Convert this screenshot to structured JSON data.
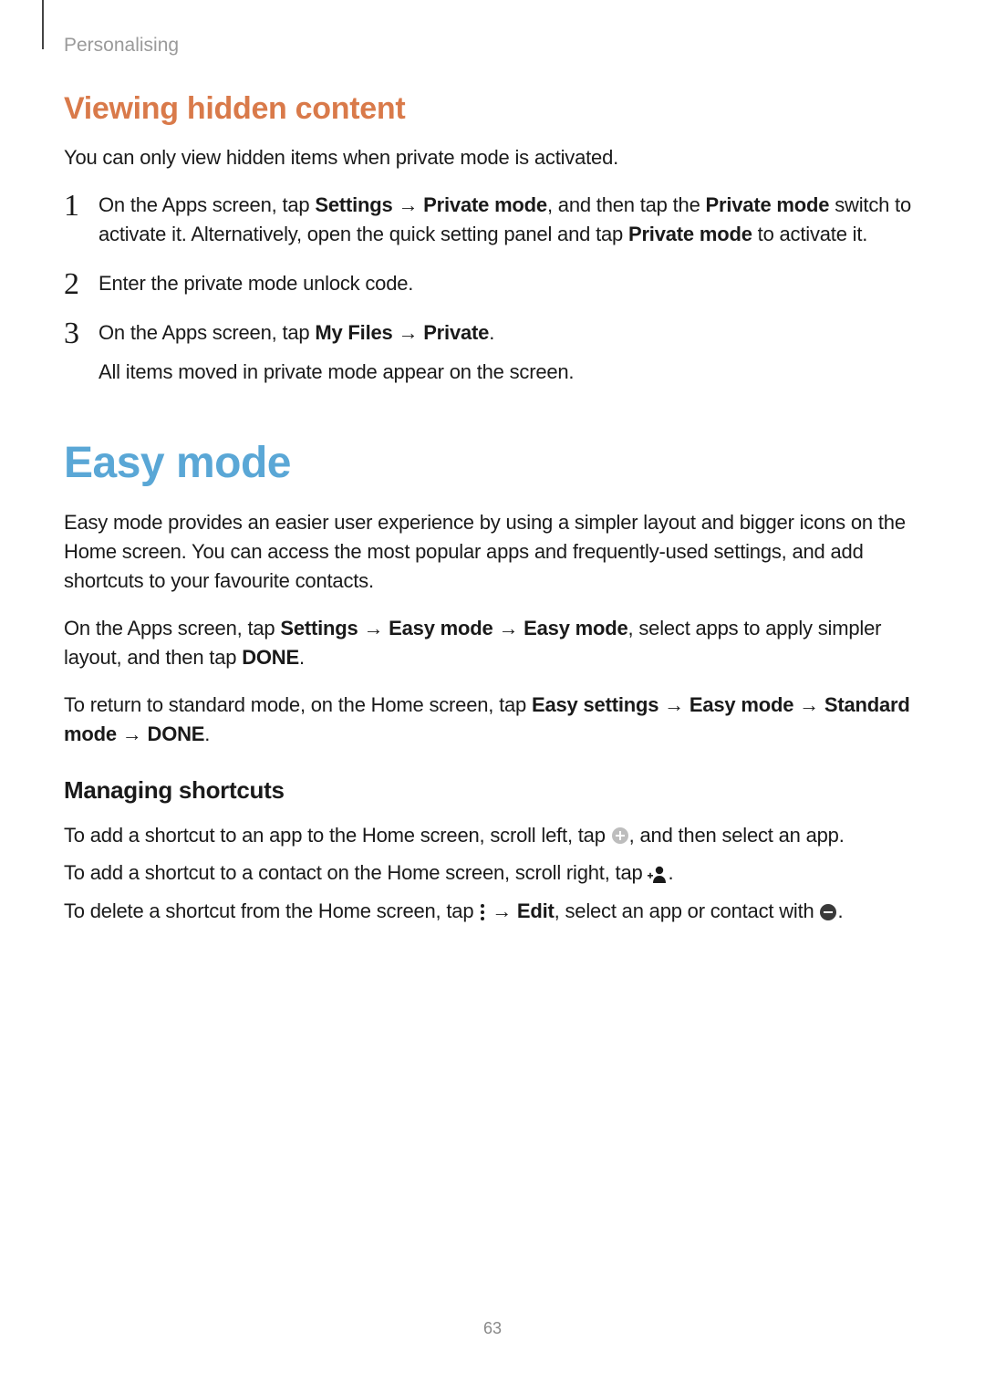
{
  "breadcrumb": "Personalising",
  "section1": {
    "heading": "Viewing hidden content",
    "intro": "You can only view hidden items when private mode is activated.",
    "steps": [
      {
        "num": "1",
        "parts": [
          {
            "t": "text",
            "v": "On the Apps screen, tap "
          },
          {
            "t": "bold",
            "v": "Settings"
          },
          {
            "t": "text",
            "v": " → "
          },
          {
            "t": "bold",
            "v": "Private mode"
          },
          {
            "t": "text",
            "v": ", and then tap the "
          },
          {
            "t": "bold",
            "v": "Private mode"
          },
          {
            "t": "text",
            "v": " switch to activate it. Alternatively, open the quick setting panel and tap "
          },
          {
            "t": "bold",
            "v": "Private mode"
          },
          {
            "t": "text",
            "v": " to activate it."
          }
        ]
      },
      {
        "num": "2",
        "parts": [
          {
            "t": "text",
            "v": "Enter the private mode unlock code."
          }
        ]
      },
      {
        "num": "3",
        "parts": [
          {
            "t": "text",
            "v": "On the Apps screen, tap "
          },
          {
            "t": "bold",
            "v": "My Files"
          },
          {
            "t": "text",
            "v": " → "
          },
          {
            "t": "bold",
            "v": "Private"
          },
          {
            "t": "text",
            "v": "."
          }
        ],
        "after": "All items moved in private mode appear on the screen."
      }
    ]
  },
  "section2": {
    "heading": "Easy mode",
    "paras": [
      [
        {
          "t": "text",
          "v": "Easy mode provides an easier user experience by using a simpler layout and bigger icons on the Home screen. You can access the most popular apps and frequently-used settings, and add shortcuts to your favourite contacts."
        }
      ],
      [
        {
          "t": "text",
          "v": "On the Apps screen, tap "
        },
        {
          "t": "bold",
          "v": "Settings"
        },
        {
          "t": "text",
          "v": " → "
        },
        {
          "t": "bold",
          "v": "Easy mode"
        },
        {
          "t": "text",
          "v": " → "
        },
        {
          "t": "bold",
          "v": "Easy mode"
        },
        {
          "t": "text",
          "v": ", select apps to apply simpler layout, and then tap "
        },
        {
          "t": "bold",
          "v": "DONE"
        },
        {
          "t": "text",
          "v": "."
        }
      ],
      [
        {
          "t": "text",
          "v": "To return to standard mode, on the Home screen, tap "
        },
        {
          "t": "bold",
          "v": "Easy settings"
        },
        {
          "t": "text",
          "v": " → "
        },
        {
          "t": "bold",
          "v": "Easy mode"
        },
        {
          "t": "text",
          "v": " → "
        },
        {
          "t": "bold",
          "v": "Standard mode"
        },
        {
          "t": "text",
          "v": " → "
        },
        {
          "t": "bold",
          "v": "DONE"
        },
        {
          "t": "text",
          "v": "."
        }
      ]
    ],
    "subheading": "Managing shortcuts",
    "shortcut_paras": [
      [
        {
          "t": "text",
          "v": "To add a shortcut to an app to the Home screen, scroll left, tap "
        },
        {
          "t": "icon",
          "v": "plus-circle-icon"
        },
        {
          "t": "text",
          "v": ", and then select an app."
        }
      ],
      [
        {
          "t": "text",
          "v": "To add a shortcut to a contact on the Home screen, scroll right, tap "
        },
        {
          "t": "icon",
          "v": "add-contact-icon"
        },
        {
          "t": "text",
          "v": "."
        }
      ],
      [
        {
          "t": "text",
          "v": "To delete a shortcut from the Home screen, tap "
        },
        {
          "t": "icon",
          "v": "more-options-icon"
        },
        {
          "t": "text",
          "v": " → "
        },
        {
          "t": "bold",
          "v": "Edit"
        },
        {
          "t": "text",
          "v": ", select an app or contact with "
        },
        {
          "t": "icon",
          "v": "minus-circle-icon"
        },
        {
          "t": "text",
          "v": "."
        }
      ]
    ]
  },
  "page_number": "63"
}
